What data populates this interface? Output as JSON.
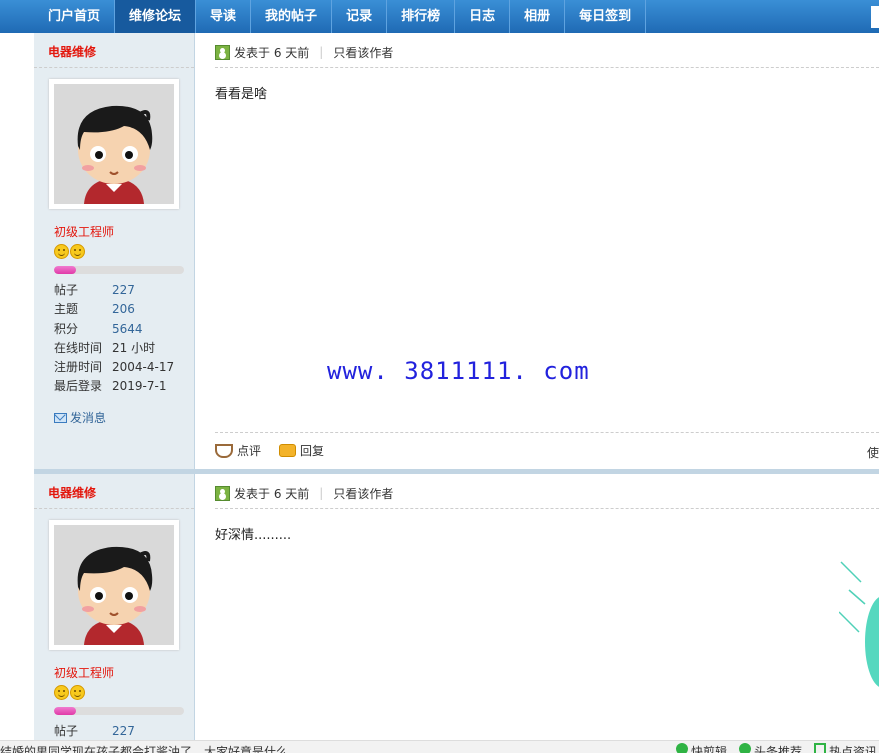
{
  "nav": {
    "items": [
      "门户首页",
      "维修论坛",
      "导读",
      "我的帖子",
      "记录",
      "排行榜",
      "日志",
      "相册",
      "每日签到"
    ],
    "active_index": 1
  },
  "posts": [
    {
      "author": "电器维修",
      "rank": "初级工程师",
      "level_progress": 0.17,
      "stats": [
        {
          "label": "帖子",
          "value": "227"
        },
        {
          "label": "主题",
          "value": "206"
        },
        {
          "label": "积分",
          "value": "5644"
        },
        {
          "label": "在线时间",
          "value": "21 小时"
        },
        {
          "label": "注册时间",
          "value": "2004-4-17"
        },
        {
          "label": "最后登录",
          "value": "2019-7-1"
        }
      ],
      "pm_label": "发消息",
      "posted": "发表于 6 天前",
      "author_only": "只看该作者",
      "text": "看看是啥",
      "watermark": "www. 3811111. com",
      "actions": {
        "comment": "点评",
        "reply": "回复"
      },
      "right_cut": "使"
    },
    {
      "author": "电器维修",
      "rank": "初级工程师",
      "level_progress": 0.17,
      "stats": [
        {
          "label": "帖子",
          "value": "227"
        }
      ],
      "posted": "发表于 6 天前",
      "author_only": "只看该作者",
      "text": "好深情........."
    }
  ],
  "status_bar": {
    "left_text": "结婚的男同学现在孩子都会打酱油了，大家好意是什么",
    "items": [
      "快剪辑",
      "头条推荐",
      "热点资讯"
    ]
  }
}
